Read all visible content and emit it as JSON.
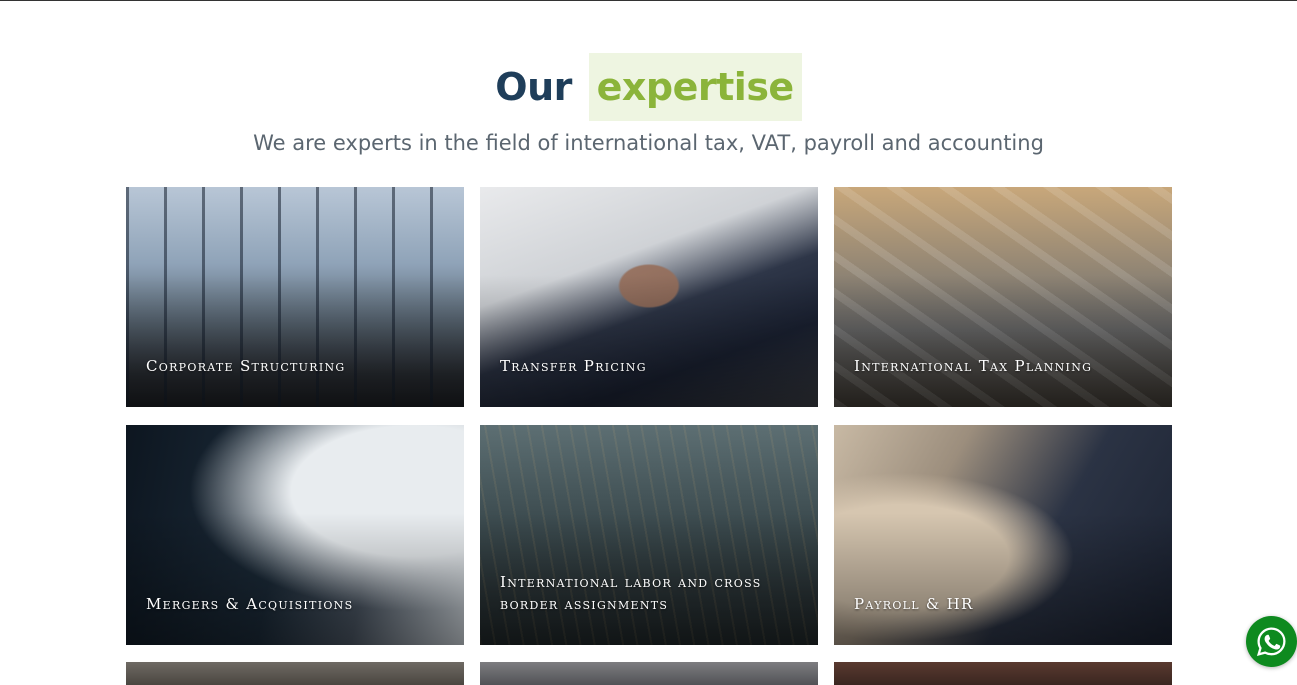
{
  "section": {
    "title_part1": "Our",
    "title_part2": "expertise",
    "subtitle": "We are experts in the field of international tax, VAT, payroll and accounting"
  },
  "cards": [
    {
      "label": "Corporate Structuring"
    },
    {
      "label": "Transfer Pricing"
    },
    {
      "label": "International Tax Planning"
    },
    {
      "label": "Mergers & Acquisitions"
    },
    {
      "label": "International labor and cross border assignments"
    },
    {
      "label": "Payroll & HR"
    }
  ],
  "floating": {
    "whatsapp_icon": "whatsapp-icon",
    "whatsapp_color": "#0e8a1f"
  },
  "colors": {
    "title_dark": "#1f3e5a",
    "title_accent": "#8bb43a",
    "accent_highlight": "#eef5e1",
    "subtitle": "#5b6670"
  }
}
